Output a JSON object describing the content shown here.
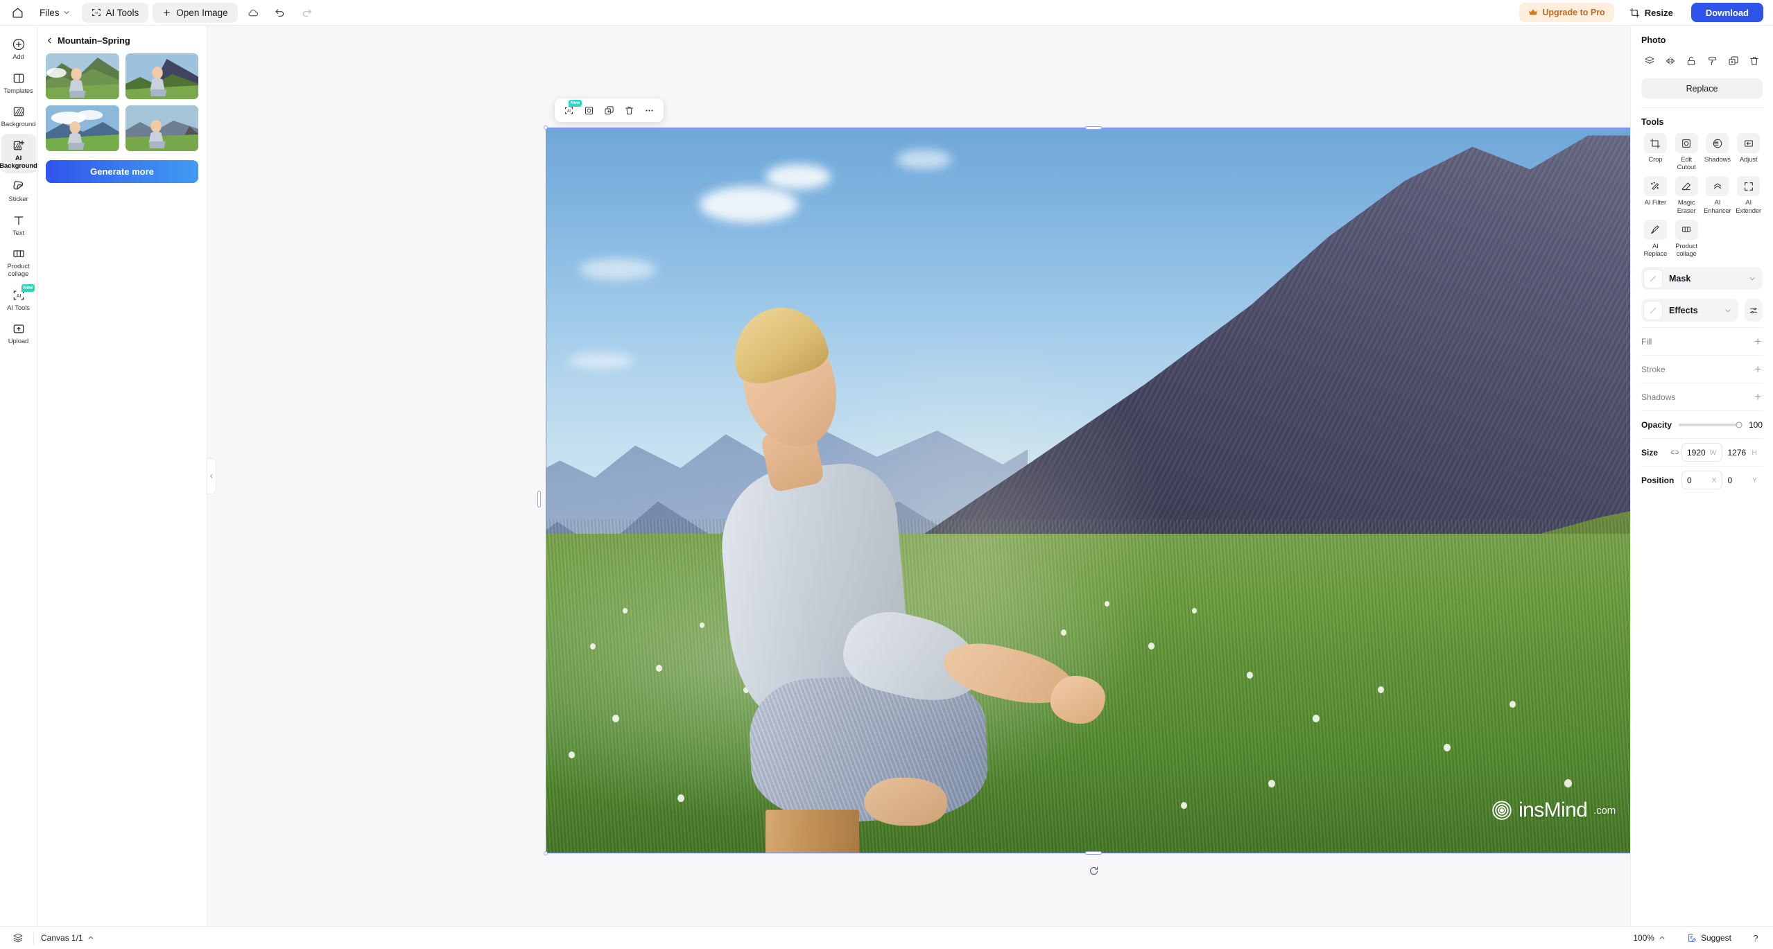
{
  "topbar": {
    "home_icon": "home-icon",
    "files_label": "Files",
    "files_chevron": "chevron-down-icon",
    "ai_tools_label": "AI Tools",
    "open_image_label": "Open Image",
    "cloud_icon": "cloud-sync-icon",
    "undo_icon": "undo-icon",
    "redo_icon": "redo-icon",
    "upgrade_label": "Upgrade to Pro",
    "upgrade_icon": "crown-icon",
    "resize_label": "Resize",
    "resize_icon": "resize-crop-icon",
    "download_label": "Download",
    "accent_color": "#2f54eb",
    "upgrade_bg": "#fdeedd",
    "upgrade_text_color": "#c2691a"
  },
  "rail": {
    "items": [
      {
        "label": "Add",
        "icon": "plus-circle-icon",
        "active": false,
        "badge": ""
      },
      {
        "label": "Templates",
        "icon": "templates-icon",
        "active": false,
        "badge": ""
      },
      {
        "label": "Background",
        "icon": "background-icon",
        "active": false,
        "badge": ""
      },
      {
        "label": "AI Background",
        "icon": "ai-background-icon",
        "active": true,
        "badge": ""
      },
      {
        "label": "Sticker",
        "icon": "sticker-icon",
        "active": false,
        "badge": ""
      },
      {
        "label": "Text",
        "icon": "text-icon",
        "active": false,
        "badge": ""
      },
      {
        "label": "Product collage",
        "icon": "product-collage-icon",
        "active": false,
        "badge": ""
      },
      {
        "label": "AI Tools",
        "icon": "ai-tools-icon",
        "active": false,
        "badge": "New"
      },
      {
        "label": "Upload",
        "icon": "upload-icon",
        "active": false,
        "badge": ""
      }
    ]
  },
  "panel": {
    "back_icon": "chevron-left-icon",
    "title": "Mountain–Spring",
    "generate_label": "Generate more",
    "thumbnails": [
      {
        "name": "result-1"
      },
      {
        "name": "result-2"
      },
      {
        "name": "result-3"
      },
      {
        "name": "result-4"
      }
    ],
    "collapse_icon": "chevron-left-icon"
  },
  "float_toolbar": {
    "buttons": [
      {
        "name": "ai-tools-icon",
        "badge": "New"
      },
      {
        "name": "edit-cutout-icon",
        "badge": ""
      },
      {
        "name": "duplicate-icon",
        "badge": ""
      },
      {
        "name": "delete-icon",
        "badge": ""
      },
      {
        "name": "more-options-icon",
        "badge": ""
      }
    ]
  },
  "canvas": {
    "watermark_text": "insMind",
    "watermark_domain": ".com",
    "watermark_icon": "insmind-logo-icon",
    "selection_color": "#7b8cff",
    "rotate_icon": "rotate-handle-icon"
  },
  "right": {
    "title": "Photo",
    "icon_buttons": [
      {
        "name": "layers-icon"
      },
      {
        "name": "flip-icon"
      },
      {
        "name": "unlock-icon"
      },
      {
        "name": "paint-roller-icon"
      },
      {
        "name": "duplicate-icon"
      },
      {
        "name": "delete-icon"
      }
    ],
    "replace_label": "Replace",
    "tools_title": "Tools",
    "tools": [
      {
        "label": "Crop",
        "icon": "crop-icon"
      },
      {
        "label": "Edit Cutout",
        "icon": "edit-cutout-icon"
      },
      {
        "label": "Shadows",
        "icon": "shadows-icon"
      },
      {
        "label": "Adjust",
        "icon": "adjust-icon"
      },
      {
        "label": "AI Filter",
        "icon": "ai-filter-icon"
      },
      {
        "label": "Magic Eraser",
        "icon": "magic-eraser-icon"
      },
      {
        "label": "AI Enhancer",
        "icon": "ai-enhancer-icon"
      },
      {
        "label": "AI Extender",
        "icon": "ai-extender-icon"
      },
      {
        "label": "AI Replace",
        "icon": "ai-replace-icon"
      },
      {
        "label": "Product collage",
        "icon": "product-collage-icon"
      }
    ],
    "mask_label": "Mask",
    "effects_label": "Effects",
    "effects_settings_icon": "sliders-icon",
    "chevron_icon": "chevron-down-icon",
    "fill_label": "Fill",
    "stroke_label": "Stroke",
    "shadows_label": "Shadows",
    "opacity_label": "Opacity",
    "opacity_value": "100",
    "size_label": "Size",
    "size_link_icon": "link-icon",
    "size_w_value": "1920",
    "size_w_suffix": "W",
    "size_h_value": "1276",
    "size_h_suffix": "H",
    "position_label": "Position",
    "position_x_value": "0",
    "position_x_suffix": "X",
    "position_y_value": "0",
    "position_y_suffix": "Y",
    "add_icon": "plus-icon"
  },
  "statusbar": {
    "layers_icon": "layers-icon",
    "canvas_label": "Canvas 1/1",
    "canvas_chevron": "chevron-up-icon",
    "zoom_label": "100%",
    "zoom_chevron": "chevron-up-icon",
    "suggest_label": "Suggest",
    "suggest_icon": "suggest-note-icon",
    "help_label": "?"
  }
}
